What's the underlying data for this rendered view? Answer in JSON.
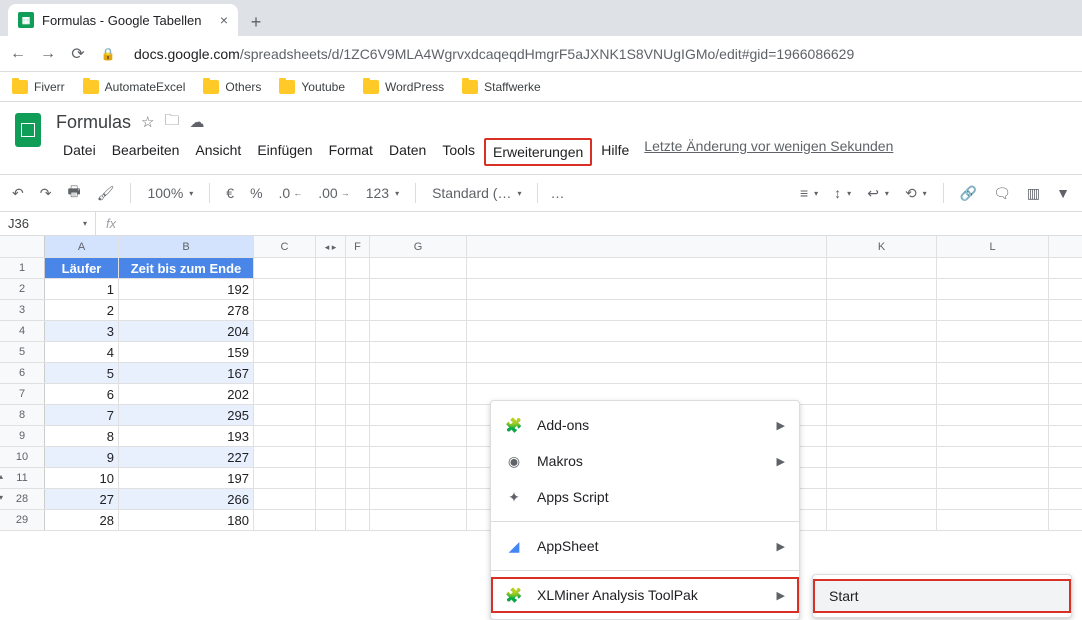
{
  "browser": {
    "tab_title": "Formulas - Google Tabellen",
    "url_host": "docs.google.com",
    "url_path": "/spreadsheets/d/1ZC6V9MLA4WgrvxdcaqeqdHmgrF5aJXNK1S8VNUgIGMo/edit#gid=1966086629",
    "bookmarks": [
      "Fiverr",
      "AutomateExcel",
      "Others",
      "Youtube",
      "WordPress",
      "Staffwerke"
    ]
  },
  "doc": {
    "title": "Formulas",
    "menus": [
      "Datei",
      "Bearbeiten",
      "Ansicht",
      "Einfügen",
      "Format",
      "Daten",
      "Tools",
      "Erweiterungen",
      "Hilfe"
    ],
    "highlighted_menu": "Erweiterungen",
    "status": "Letzte Änderung vor wenigen Sekunden"
  },
  "toolbar": {
    "zoom": "100%",
    "currency": "€",
    "percent": "%",
    "dec_dec": ".0",
    "inc_dec": ".00",
    "numfmt": "123",
    "font": "Standard (…"
  },
  "namebox": "J36",
  "fx": "fx",
  "columns": [
    "A",
    "B",
    "C",
    "F",
    "G",
    "K",
    "L"
  ],
  "headers": {
    "A": "Läufer",
    "B": "Zeit bis zum Ende"
  },
  "rows": [
    {
      "n": "1",
      "A": "Läufer",
      "B": "Zeit bis zum Ende",
      "hdr": true
    },
    {
      "n": "2",
      "A": "1",
      "B": "192"
    },
    {
      "n": "3",
      "A": "2",
      "B": "278"
    },
    {
      "n": "4",
      "A": "3",
      "B": "204",
      "band": true
    },
    {
      "n": "5",
      "A": "4",
      "B": "159"
    },
    {
      "n": "6",
      "A": "5",
      "B": "167",
      "band": true
    },
    {
      "n": "7",
      "A": "6",
      "B": "202"
    },
    {
      "n": "8",
      "A": "7",
      "B": "295",
      "band": true
    },
    {
      "n": "9",
      "A": "8",
      "B": "193"
    },
    {
      "n": "10",
      "A": "9",
      "B": "227",
      "band": true
    },
    {
      "n": "11",
      "A": "10",
      "B": "197",
      "arr": "up"
    },
    {
      "n": "28",
      "A": "27",
      "B": "266",
      "band": true,
      "arr": "down"
    },
    {
      "n": "29",
      "A": "28",
      "B": "180"
    }
  ],
  "dropdown": {
    "items": [
      {
        "label": "Add-ons",
        "icon": "puzzle",
        "arrow": true
      },
      {
        "label": "Makros",
        "icon": "record",
        "arrow": true
      },
      {
        "label": "Apps Script",
        "icon": "apps-script"
      },
      {
        "sep": true
      },
      {
        "label": "AppSheet",
        "icon": "appsheet",
        "arrow": true
      },
      {
        "sep": true
      },
      {
        "label": "XLMiner Analysis ToolPak",
        "icon": "puzzle",
        "arrow": true,
        "hl": true
      }
    ]
  },
  "submenu": {
    "start": "Start"
  }
}
